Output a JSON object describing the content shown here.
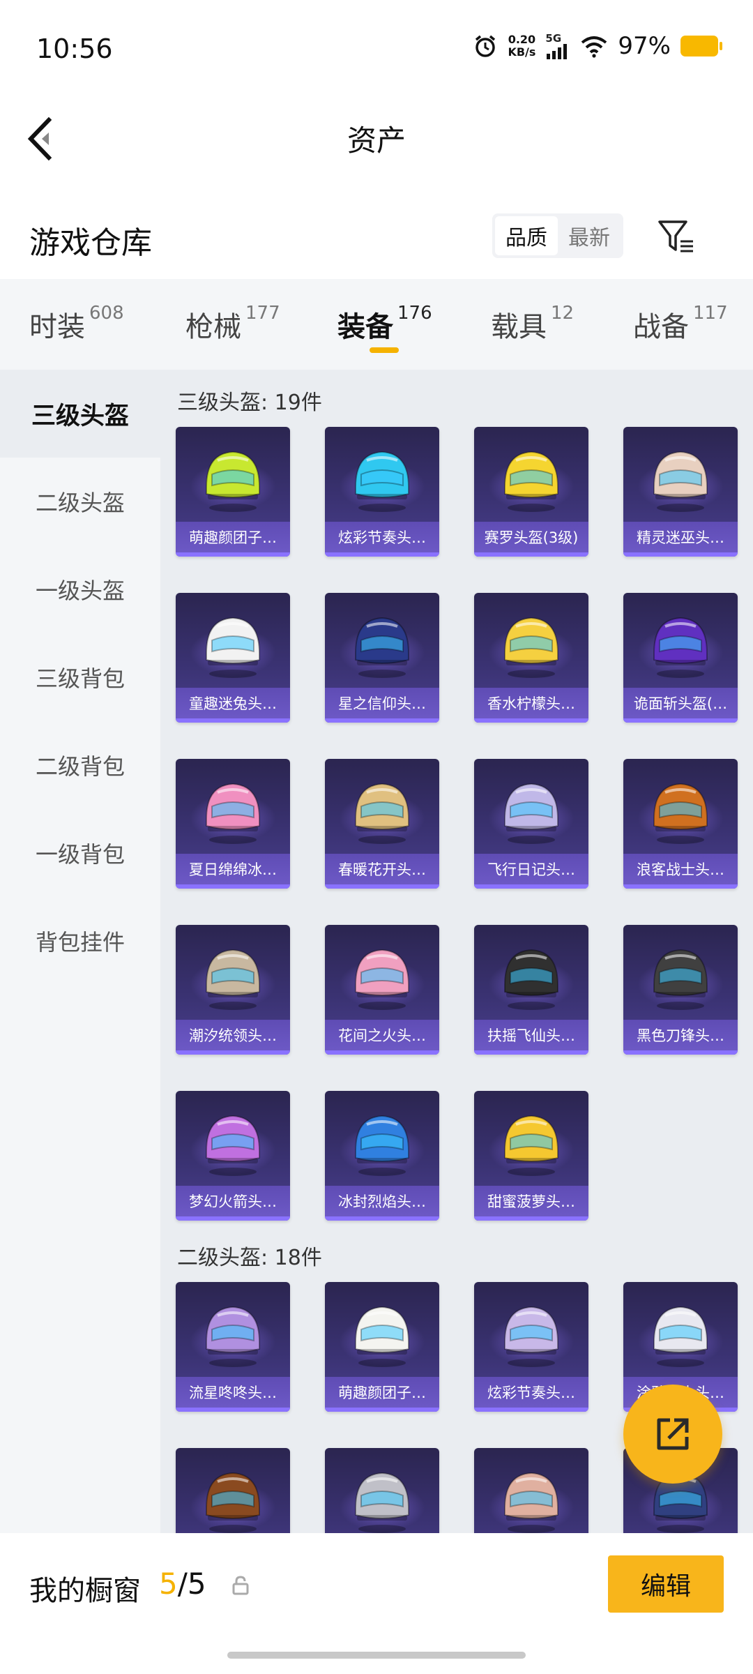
{
  "status_bar": {
    "time": "10:56",
    "net_speed_value": "0.20",
    "net_speed_unit": "KB/s",
    "network": "5G",
    "battery": "97%"
  },
  "nav": {
    "title": "资产"
  },
  "warehouse": {
    "title": "游戏仓库",
    "sort_options": [
      "品质",
      "最新"
    ],
    "sort_selected": "品质"
  },
  "categories": [
    {
      "label": "时装",
      "count": "608"
    },
    {
      "label": "枪械",
      "count": "177"
    },
    {
      "label": "装备",
      "count": "176"
    },
    {
      "label": "载具",
      "count": "12"
    },
    {
      "label": "战备",
      "count": "117"
    }
  ],
  "active_category": "装备",
  "sidebar": {
    "items": [
      "三级头盔",
      "二级头盔",
      "一级头盔",
      "三级背包",
      "二级背包",
      "一级背包",
      "背包挂件"
    ],
    "active": "三级头盔"
  },
  "sections": [
    {
      "title": "三级头盔: 19件",
      "items": [
        "萌趣颜团子…",
        "炫彩节奏头…",
        "赛罗头盔(3级)",
        "精灵迷巫头…",
        "童趣迷兔头…",
        "星之信仰头…",
        "香水柠檬头…",
        "诡面斩头盔(…",
        "夏日绵绵冰…",
        "春暖花开头…",
        "飞行日记头…",
        "浪客战士头…",
        "潮汐统领头…",
        "花间之火头…",
        "扶摇飞仙头…",
        "黑色刀锋头…",
        "梦幻火箭头…",
        "冰封烈焰头…",
        "甜蜜菠萝头…"
      ]
    },
    {
      "title": "二级头盔: 18件",
      "items": [
        "流星咚咚头…",
        "萌趣颜团子…",
        "炫彩节奏头…",
        "涂鸦战士头…",
        "",
        "",
        "",
        ""
      ]
    }
  ],
  "item_colors": {
    "s0": [
      "#c8e830",
      "#30c8f0",
      "#f5d530",
      "#e8d0c0",
      "#f2f2f2",
      "#2a3a8a",
      "#f5d040",
      "#6030c0",
      "#f090c0",
      "#e0c080",
      "#c0b8e8",
      "#d07020",
      "#c8b8a0",
      "#f0a0c0",
      "#303030",
      "#404040",
      "#c070e0",
      "#3080e0",
      "#f5c830"
    ],
    "s1": [
      "#b090e0",
      "#f4f4f0",
      "#c8b8e8",
      "#e8e8f0",
      "#8a4a20",
      "#c0c0c8",
      "#e0b0a0",
      "#304080"
    ]
  },
  "bottom": {
    "showcase_label": "我的橱窗",
    "showcase_current": "5",
    "showcase_total": "/5",
    "edit_label": "编辑"
  },
  "colors": {
    "accent": "#f8b51b",
    "card_bg": "#3a3272",
    "name_bar": "#6c58c8"
  }
}
